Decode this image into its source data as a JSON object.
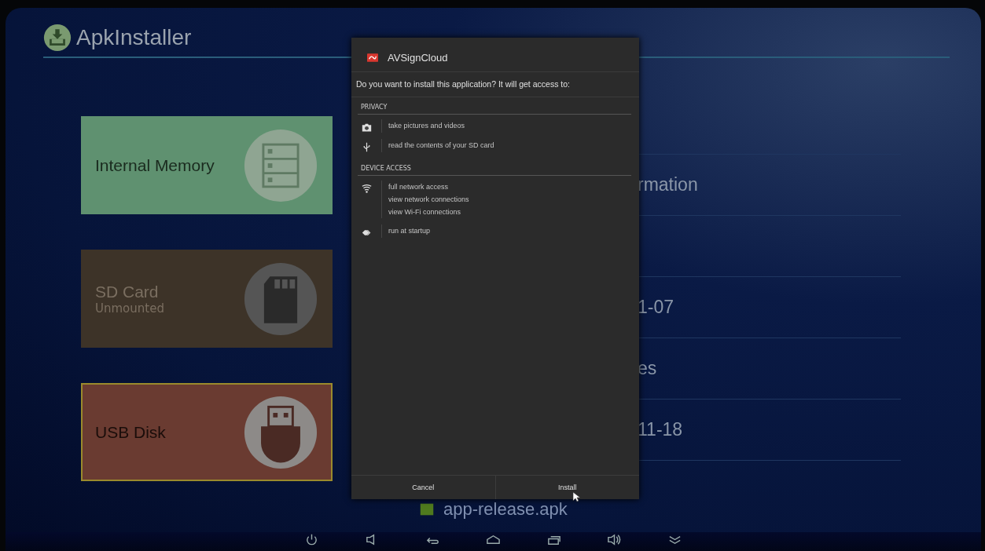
{
  "app": {
    "title": "ApkInstaller"
  },
  "storage_tiles": [
    {
      "kind": "internal",
      "label": "Internal Memory",
      "color": "#5f9170",
      "selected": false
    },
    {
      "kind": "sdcard",
      "label": "SD Card",
      "sublabel": "Unmounted",
      "color": "#3d3328",
      "selected": false
    },
    {
      "kind": "usb",
      "label": "USB Disk",
      "color": "#6a3b31",
      "selected": true
    }
  ],
  "info_rows": [
    {
      "text": "rmation"
    },
    {},
    {
      "text": "1-07"
    },
    {
      "text": "es"
    },
    {
      "text": "11-18"
    }
  ],
  "file": {
    "name": "app-release.apk"
  },
  "dialog": {
    "app_name": "AVSignCloud",
    "question": "Do you want to install this application? It will get access to:",
    "groups": [
      {
        "heading": "PRIVACY",
        "permissions": [
          {
            "kind": "camera",
            "lines": [
              "take pictures and videos"
            ]
          },
          {
            "kind": "usb",
            "lines": [
              "read the contents of your SD card"
            ]
          }
        ]
      },
      {
        "heading": "DEVICE ACCESS",
        "permissions": [
          {
            "kind": "wifi",
            "lines": [
              "full network access",
              "view network connections",
              "view Wi-Fi connections"
            ]
          },
          {
            "kind": "startup",
            "lines": [
              "run at startup"
            ]
          }
        ]
      }
    ],
    "buttons": [
      "Cancel",
      "Install"
    ]
  }
}
